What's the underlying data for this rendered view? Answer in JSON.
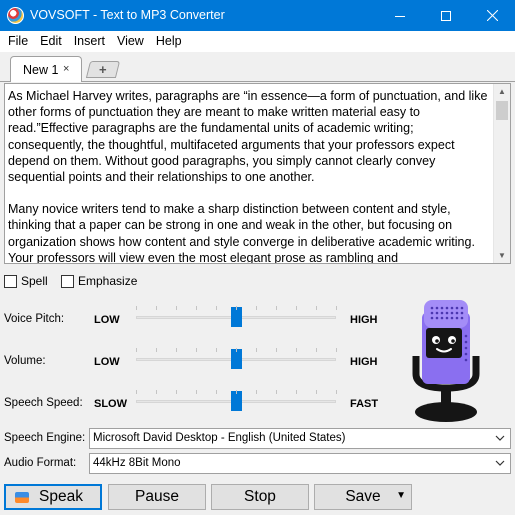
{
  "window": {
    "title": "VOVSOFT - Text to MP3 Converter",
    "accent_color": "#0078d7"
  },
  "menu": [
    "File",
    "Edit",
    "Insert",
    "View",
    "Help"
  ],
  "tabs": {
    "active_label": "New 1",
    "close_glyph": "×",
    "new_tab_glyph": "+"
  },
  "editor": {
    "paragraphs": [
      "As Michael Harvey writes, paragraphs are “in essence—a form of punctuation, and like other forms of punctuation they are meant to make written material easy to read.”Effective paragraphs are the fundamental units of academic writing; consequently, the thoughtful, multifaceted arguments that your professors expect depend on them. Without good paragraphs, you simply cannot clearly convey sequential points and their relationships to one another.",
      "Many novice writers tend to make a sharp distinction between content and style, thinking that a paper can be strong in one and weak in the other, but focusing on organization shows how content and style converge in deliberative academic writing. Your professors will view even the most elegant prose as rambling and"
    ]
  },
  "options": {
    "spell_label": "Spell",
    "emphasize_label": "Emphasize",
    "spell_checked": false,
    "emphasize_checked": false
  },
  "sliders": [
    {
      "label": "Voice Pitch:",
      "low": "LOW",
      "high": "HIGH",
      "value": 0.5
    },
    {
      "label": "Volume:",
      "low": "LOW",
      "high": "HIGH",
      "value": 0.5
    },
    {
      "label": "Speech Speed:",
      "low": "SLOW",
      "high": "FAST",
      "value": 0.5
    }
  ],
  "engine": {
    "label": "Speech Engine:",
    "value": "Microsoft David Desktop - English (United States)"
  },
  "format": {
    "label": "Audio Format:",
    "value": "44kHz 8Bit Mono"
  },
  "buttons": {
    "speak": "Speak",
    "pause": "Pause",
    "stop": "Stop",
    "save": "Save"
  },
  "icons": {
    "app": "vovsoft-app-icon",
    "mic": "microphone-mascot-icon"
  }
}
